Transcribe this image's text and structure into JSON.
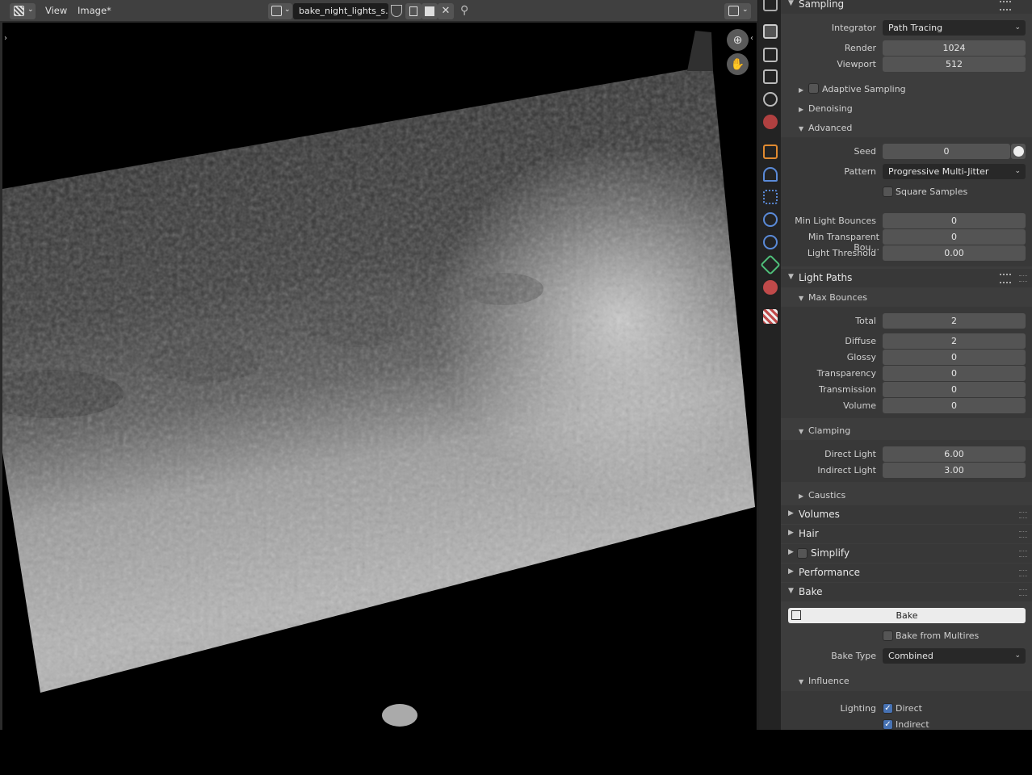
{
  "header": {
    "menus": [
      "View",
      "Image*"
    ],
    "image_name": "bake_night_lights_s..."
  },
  "sampling": {
    "title": "Sampling",
    "integrator_label": "Integrator",
    "integrator_value": "Path Tracing",
    "render_label": "Render",
    "render_value": "1024",
    "viewport_label": "Viewport",
    "viewport_value": "512",
    "adaptive_sampling": "Adaptive Sampling",
    "denoising": "Denoising",
    "advanced": "Advanced",
    "seed_label": "Seed",
    "seed_value": "0",
    "pattern_label": "Pattern",
    "pattern_value": "Progressive Multi-Jitter",
    "square_samples": "Square Samples",
    "min_light_bounces_label": "Min Light Bounces",
    "min_light_bounces_value": "0",
    "min_transparent_label": "Min Transparent Bou...",
    "min_transparent_value": "0",
    "light_threshold_label": "Light Threshold",
    "light_threshold_value": "0.00"
  },
  "light_paths": {
    "title": "Light Paths",
    "max_bounces": "Max Bounces",
    "rows": [
      {
        "label": "Total",
        "value": "2"
      },
      {
        "label": "Diffuse",
        "value": "2"
      },
      {
        "label": "Glossy",
        "value": "0"
      },
      {
        "label": "Transparency",
        "value": "0"
      },
      {
        "label": "Transmission",
        "value": "0"
      },
      {
        "label": "Volume",
        "value": "0"
      }
    ],
    "clamping": "Clamping",
    "direct_light_label": "Direct Light",
    "direct_light_value": "6.00",
    "indirect_light_label": "Indirect Light",
    "indirect_light_value": "3.00",
    "caustics": "Caustics"
  },
  "collapsed_panels": [
    "Volumes",
    "Hair",
    "Simplify",
    "Performance"
  ],
  "bake": {
    "title": "Bake",
    "bake_button": "Bake",
    "bake_from_multires": "Bake from Multires",
    "bake_type_label": "Bake Type",
    "bake_type_value": "Combined",
    "influence": "Influence",
    "lighting_label": "Lighting",
    "direct": "Direct",
    "indirect": "Indirect"
  },
  "colors": {
    "accent": "#4772b3",
    "field": "#545454",
    "dropdown": "#282828"
  }
}
